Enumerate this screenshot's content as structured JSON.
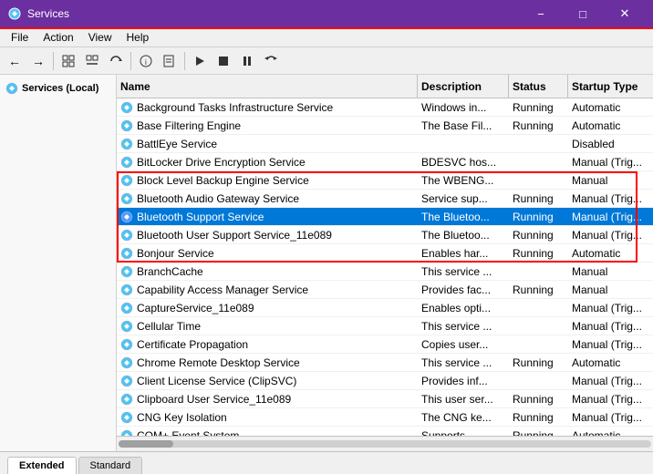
{
  "titleBar": {
    "title": "Services",
    "minBtn": "−",
    "maxBtn": "□",
    "closeBtn": "✕"
  },
  "menuBar": {
    "items": [
      "File",
      "Action",
      "View",
      "Help"
    ]
  },
  "toolbar": {
    "buttons": [
      "←",
      "→",
      "⊞",
      "⊟",
      "↻",
      "🔍",
      "📋",
      "▶",
      "⏹",
      "⏸",
      "▶▶"
    ]
  },
  "leftPanel": {
    "title": "Services (Local)"
  },
  "tableHeaders": {
    "name": "Name",
    "description": "Description",
    "status": "Status",
    "startupType": "Startup Type"
  },
  "services": [
    {
      "name": "Background Tasks Infrastructure Service",
      "desc": "Windows in...",
      "status": "Running",
      "startup": "Automatic"
    },
    {
      "name": "Base Filtering Engine",
      "desc": "The Base Fil...",
      "status": "Running",
      "startup": "Automatic"
    },
    {
      "name": "BattlEye Service",
      "desc": "",
      "status": "",
      "startup": "Disabled"
    },
    {
      "name": "BitLocker Drive Encryption Service",
      "desc": "BDESVC hos...",
      "status": "",
      "startup": "Manual (Trig..."
    },
    {
      "name": "Block Level Backup Engine Service",
      "desc": "The WBENG...",
      "status": "",
      "startup": "Manual"
    },
    {
      "name": "Bluetooth Audio Gateway Service",
      "desc": "Service sup...",
      "status": "Running",
      "startup": "Manual (Trig..."
    },
    {
      "name": "Bluetooth Support Service",
      "desc": "The Bluetoo...",
      "status": "Running",
      "startup": "Manual (Trig...",
      "selected": true
    },
    {
      "name": "Bluetooth User Support Service_11e089",
      "desc": "The Bluetoo...",
      "status": "Running",
      "startup": "Manual (Trig..."
    },
    {
      "name": "Bonjour Service",
      "desc": "Enables har...",
      "status": "Running",
      "startup": "Automatic"
    },
    {
      "name": "BranchCache",
      "desc": "This service ...",
      "status": "",
      "startup": "Manual"
    },
    {
      "name": "Capability Access Manager Service",
      "desc": "Provides fac...",
      "status": "Running",
      "startup": "Manual"
    },
    {
      "name": "CaptureService_11e089",
      "desc": "Enables opti...",
      "status": "",
      "startup": "Manual (Trig..."
    },
    {
      "name": "Cellular Time",
      "desc": "This service ...",
      "status": "",
      "startup": "Manual (Trig..."
    },
    {
      "name": "Certificate Propagation",
      "desc": "Copies user...",
      "status": "",
      "startup": "Manual (Trig..."
    },
    {
      "name": "Chrome Remote Desktop Service",
      "desc": "This service ...",
      "status": "Running",
      "startup": "Automatic"
    },
    {
      "name": "Client License Service (ClipSVC)",
      "desc": "Provides inf...",
      "status": "",
      "startup": "Manual (Trig..."
    },
    {
      "name": "Clipboard User Service_11e089",
      "desc": "This user ser...",
      "status": "Running",
      "startup": "Manual (Trig..."
    },
    {
      "name": "CNG Key Isolation",
      "desc": "The CNG ke...",
      "status": "Running",
      "startup": "Manual (Trig..."
    },
    {
      "name": "COM+ Event System",
      "desc": "Supports...",
      "status": "Running",
      "startup": "Automatic"
    }
  ],
  "redBoxRows": [
    4,
    5,
    6,
    7,
    8
  ],
  "bottomTabs": {
    "tabs": [
      "Extended",
      "Standard"
    ],
    "active": "Extended"
  }
}
